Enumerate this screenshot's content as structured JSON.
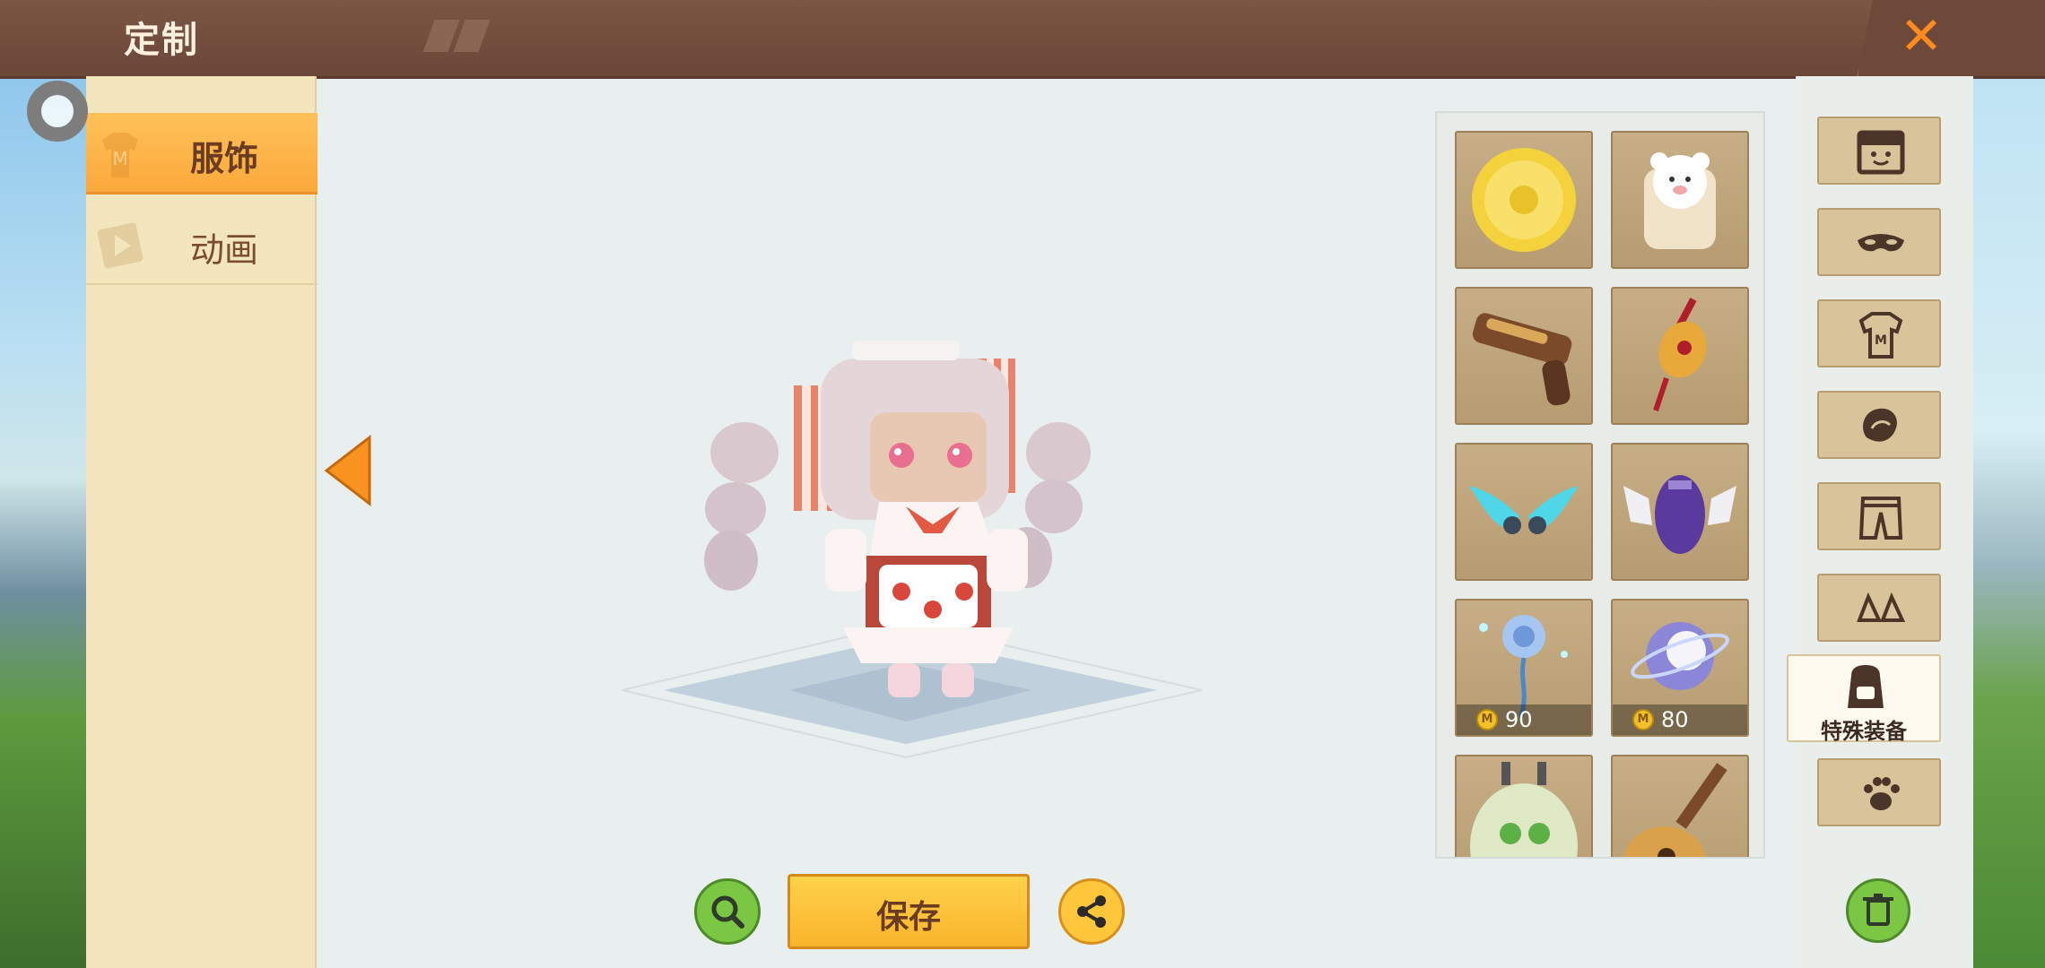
{
  "header": {
    "title": "定制",
    "close_icon": "close-icon"
  },
  "left_tabs": [
    {
      "label": "服饰",
      "icon": "shirt-icon",
      "active": true
    },
    {
      "label": "动画",
      "icon": "animation-icon",
      "active": false
    }
  ],
  "center": {
    "prev_icon": "arrow-left-icon",
    "zoom_icon": "magnifier-icon",
    "save_label": "保存",
    "share_icon": "share-icon"
  },
  "items": [
    {
      "name": "mooncake"
    },
    {
      "name": "bear-backpack"
    },
    {
      "name": "steampunk-gun"
    },
    {
      "name": "pipa-charm"
    },
    {
      "name": "cyan-wings"
    },
    {
      "name": "purple-jetpack"
    },
    {
      "name": "blue-rose",
      "price": "90"
    },
    {
      "name": "moon-orb",
      "price": "80"
    },
    {
      "name": "frog-backpack"
    },
    {
      "name": "guitar"
    }
  ],
  "categories": [
    {
      "icon": "face-icon"
    },
    {
      "icon": "mask-icon"
    },
    {
      "icon": "shirt-icon"
    },
    {
      "icon": "gloves-icon"
    },
    {
      "icon": "pants-icon"
    },
    {
      "icon": "shoes-icon"
    },
    {
      "icon": "backpack-icon",
      "label": "特殊装备",
      "active": true
    },
    {
      "icon": "paw-icon"
    }
  ],
  "colors": {
    "accent": "#fba93b",
    "header": "#6b4738",
    "green_button": "#7bc743"
  }
}
